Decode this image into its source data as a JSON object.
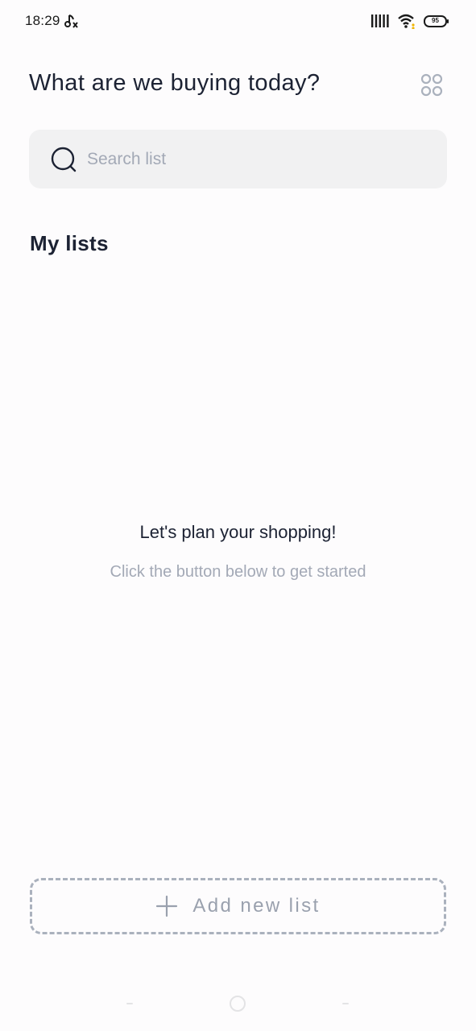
{
  "status_bar": {
    "time": "18:29",
    "app_icon": "music-muted-icon",
    "battery_level": "95",
    "icons": [
      "signal-icon",
      "wifi-icon",
      "battery-icon"
    ]
  },
  "header": {
    "title": "What are we buying today?",
    "menu_icon": "grid-dots-icon"
  },
  "search": {
    "placeholder": "Search list",
    "value": "",
    "icon": "search-icon"
  },
  "lists_section": {
    "title": "My lists",
    "items": []
  },
  "empty_state": {
    "title": "Let's plan your shopping!",
    "subtitle": "Click the button below to get started"
  },
  "add_button": {
    "label": "Add new list",
    "icon": "plus-icon"
  },
  "colors": {
    "background": "#fdfcfd",
    "text_primary": "#1c2233",
    "text_muted": "#a3a9b6",
    "search_bg": "#f1f1f2",
    "dashed_border": "#aab1bd"
  }
}
